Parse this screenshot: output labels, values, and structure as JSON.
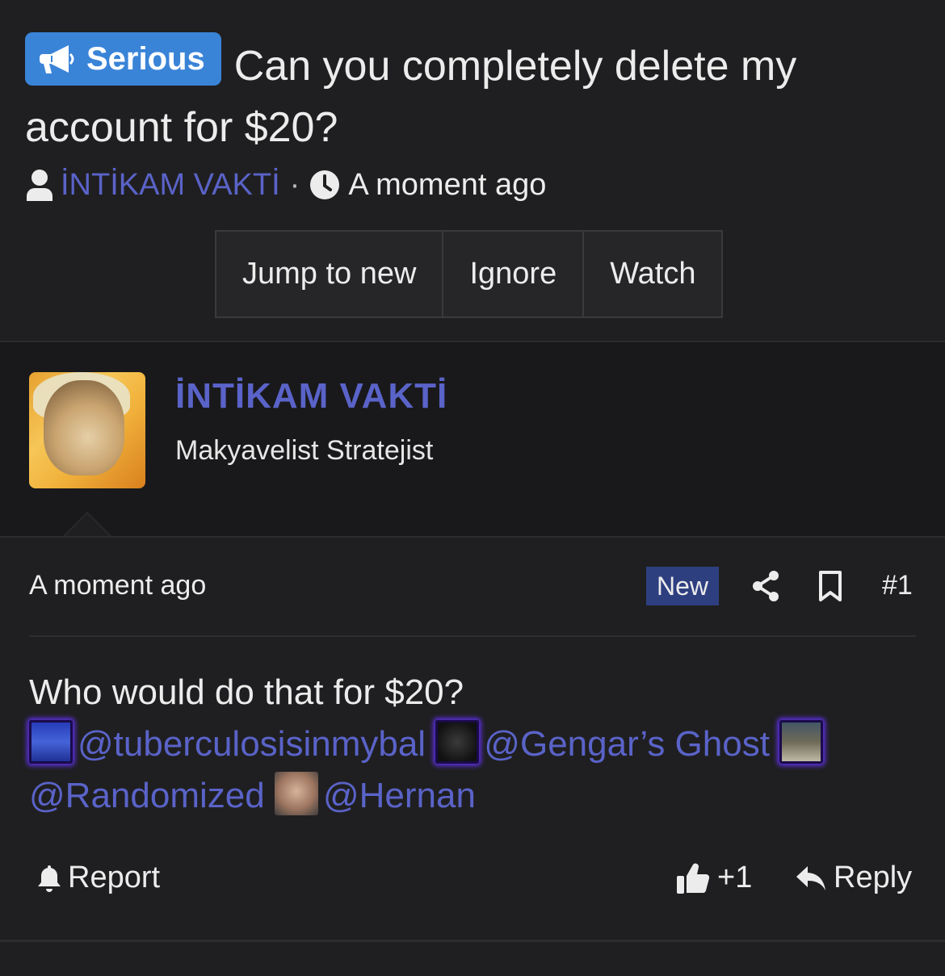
{
  "thread": {
    "prefix_label": "Serious",
    "title": "Can you completely delete my account for $20?",
    "author": "İNTİKAM VAKTİ",
    "separator": "·",
    "time": "A moment ago",
    "buttons": {
      "jump_to_new": "Jump to new",
      "ignore": "Ignore",
      "watch": "Watch"
    }
  },
  "post": {
    "username": "İNTİKAM VAKTİ",
    "user_title": "Makyavelist Stratejist",
    "time": "A moment ago",
    "badge": "New",
    "number": "#1",
    "body_line": "Who would do that for $20?",
    "mentions": [
      "@tuberculosisinmybal",
      "@Gengar’s Ghost",
      "@Randomized",
      "@Hernan"
    ],
    "actions": {
      "report": "Report",
      "like_count": "+1",
      "reply": "Reply"
    }
  },
  "colors": {
    "background": "#1f1f21",
    "user_block": "#19191b",
    "prefix": "#3a84d8",
    "link": "#5a63c8",
    "badge_new": "#2e3f80"
  },
  "icons": [
    "megaphone-icon",
    "user-icon",
    "clock-icon",
    "share-icon",
    "bookmark-icon",
    "bell-icon",
    "thumbs-up-icon",
    "reply-icon"
  ]
}
